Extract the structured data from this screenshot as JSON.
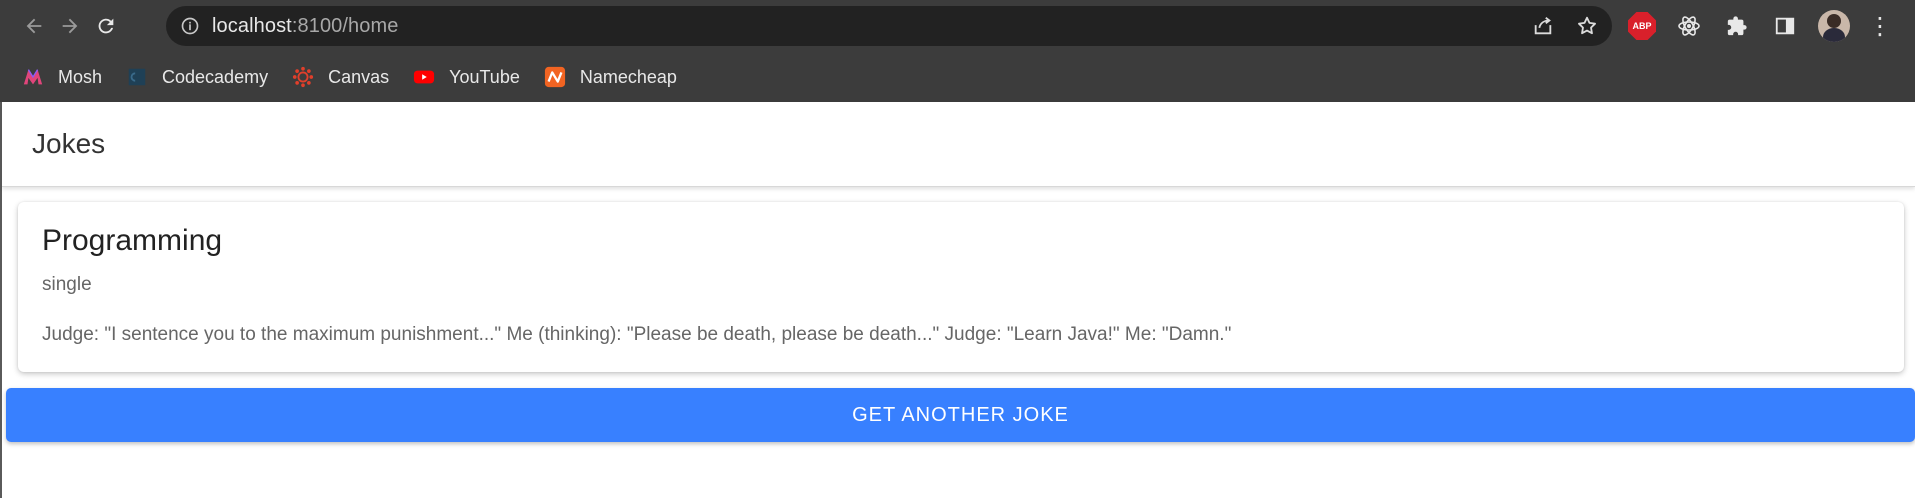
{
  "browser": {
    "url_host": "localhost",
    "url_path": ":8100/home",
    "extensions": [
      "abp-icon",
      "react-devtools-icon",
      "puzzle-icon",
      "sidepanel-icon"
    ],
    "abp_label": "ABP",
    "bookmarks": [
      {
        "label": "Mosh",
        "icon": "mosh-icon",
        "color": "#e0457b"
      },
      {
        "label": "Codecademy",
        "icon": "codecademy-icon",
        "color": "#1f4056"
      },
      {
        "label": "Canvas",
        "icon": "canvas-icon",
        "color": "#e13f2b"
      },
      {
        "label": "YouTube",
        "icon": "youtube-icon",
        "color": "#ff0000"
      },
      {
        "label": "Namecheap",
        "icon": "namecheap-icon",
        "color": "#f26422"
      }
    ]
  },
  "app": {
    "title": "Jokes",
    "card": {
      "title": "Programming",
      "subtitle": "single",
      "content": "Judge: \"I sentence you to the maximum punishment...\" Me (thinking): \"Please be death, please be death...\" Judge: \"Learn Java!\" Me: \"Damn.\""
    },
    "button_label": "GET ANOTHER JOKE",
    "accent_color": "#3880ff"
  }
}
